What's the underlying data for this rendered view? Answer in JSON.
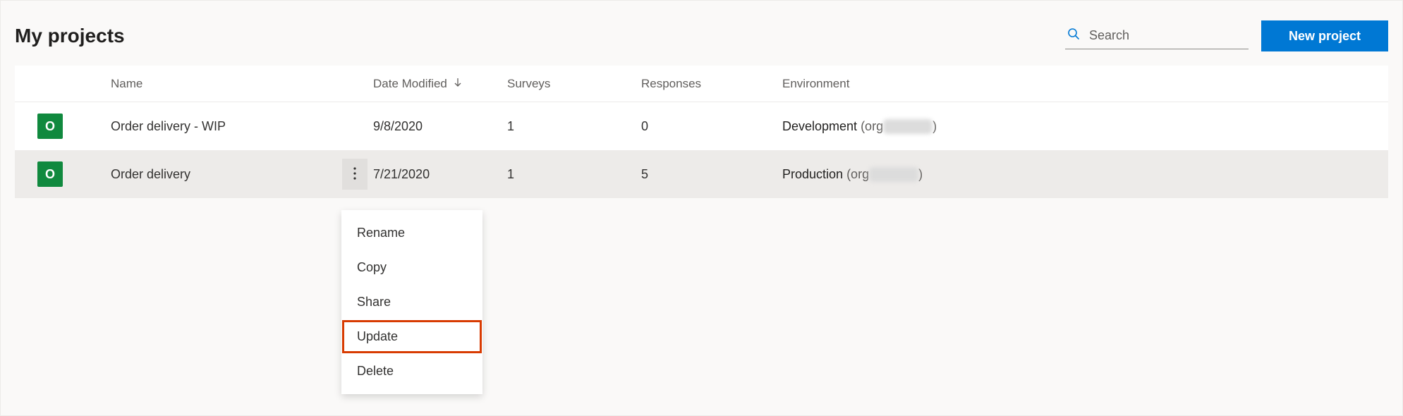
{
  "header": {
    "title": "My projects",
    "search_placeholder": "Search",
    "new_project_label": "New project"
  },
  "table": {
    "columns": {
      "name": "Name",
      "date_modified": "Date Modified",
      "surveys": "Surveys",
      "responses": "Responses",
      "environment": "Environment"
    },
    "sort": {
      "column": "date_modified",
      "direction": "desc"
    },
    "rows": [
      {
        "avatar_letter": "O",
        "avatar_color": "#10893e",
        "name": "Order delivery - WIP",
        "date_modified": "9/8/2020",
        "surveys": "1",
        "responses": "0",
        "env_label": "Development",
        "env_org_prefix": " (org",
        "env_org_suffix": ")",
        "selected": false
      },
      {
        "avatar_letter": "O",
        "avatar_color": "#10893e",
        "name": "Order delivery",
        "date_modified": "7/21/2020",
        "surveys": "1",
        "responses": "5",
        "env_label": "Production",
        "env_org_prefix": " (org",
        "env_org_suffix": ")",
        "selected": true
      }
    ]
  },
  "context_menu": {
    "items": [
      {
        "label": "Rename",
        "highlighted": false
      },
      {
        "label": "Copy",
        "highlighted": false
      },
      {
        "label": "Share",
        "highlighted": false
      },
      {
        "label": "Update",
        "highlighted": true
      },
      {
        "label": "Delete",
        "highlighted": false
      }
    ]
  }
}
